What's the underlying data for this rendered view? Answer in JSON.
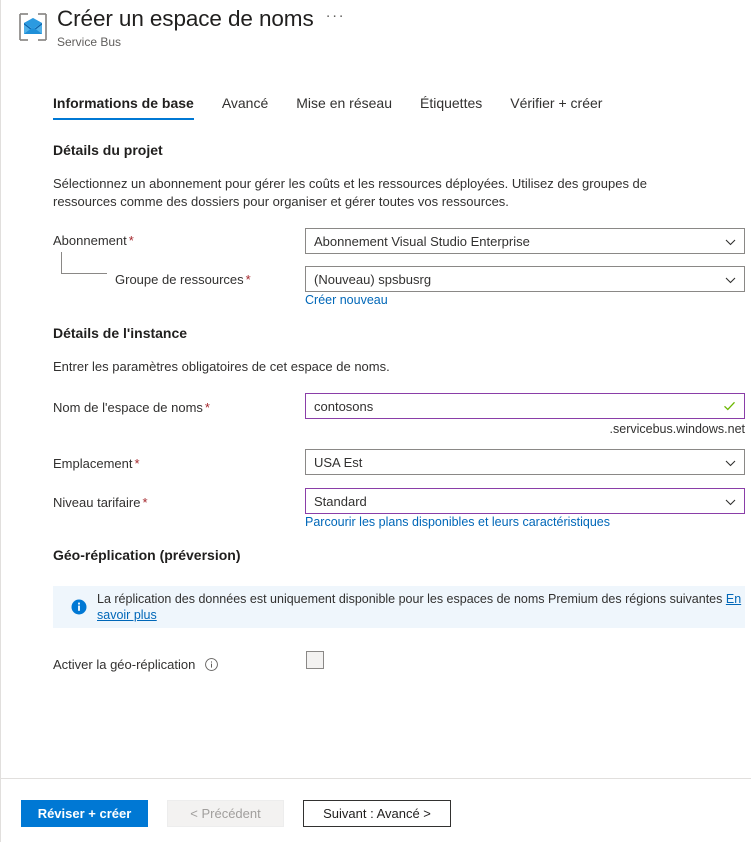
{
  "header": {
    "icon": "service-bus-envelope-icon",
    "title": "Créer un espace de noms",
    "ellipsis": "···",
    "subtitle": "Service Bus"
  },
  "tabs": [
    {
      "label": "Informations de base",
      "active": true
    },
    {
      "label": "Avancé",
      "active": false
    },
    {
      "label": "Mise en réseau",
      "active": false
    },
    {
      "label": "Étiquettes",
      "active": false
    },
    {
      "label": "Vérifier + créer",
      "active": false
    }
  ],
  "project_details": {
    "section_title": "Détails du projet",
    "description": "Sélectionnez un abonnement pour gérer les coûts et les ressources déployées. Utilisez des groupes de ressources comme des dossiers pour organiser et gérer toutes vos ressources.",
    "subscription": {
      "label": "Abonnement",
      "required": "*",
      "value": "Abonnement Visual Studio Enterprise"
    },
    "resource_group": {
      "label": "Groupe de ressources",
      "required": "*",
      "value": "(Nouveau) spsbusrg",
      "create_new_link": "Créer nouveau"
    }
  },
  "instance_details": {
    "section_title": "Détails de l'instance",
    "description": "Entrer les paramètres obligatoires de cet espace de noms.",
    "namespace_name": {
      "label": "Nom de l'espace de noms",
      "required": "*",
      "value": "contosons",
      "suffix": ".servicebus.windows.net",
      "valid": true
    },
    "location": {
      "label": "Emplacement",
      "required": "*",
      "value": "USA Est"
    },
    "pricing_tier": {
      "label": "Niveau tarifaire",
      "required": "*",
      "value": "Standard",
      "browse_link": "Parcourir les plans disponibles et leurs caractéristiques"
    }
  },
  "geo_replication": {
    "section_title": "Géo-réplication (préversion)",
    "info_message": "La réplication des données est uniquement disponible pour les espaces de noms Premium des régions suivantes",
    "info_link": "En savoir plus",
    "enable": {
      "label": "Activer la géo-réplication",
      "checked": false
    }
  },
  "footer": {
    "review_create": "Réviser + créer",
    "previous": "< Précédent",
    "next": "Suivant : Avancé >"
  },
  "colors": {
    "accent": "#0078d4",
    "link": "#0067b8",
    "required": "#a4262c",
    "focus_border": "#8a3ea8",
    "info_bg": "#eff6fc",
    "valid_check": "#6bb700"
  }
}
